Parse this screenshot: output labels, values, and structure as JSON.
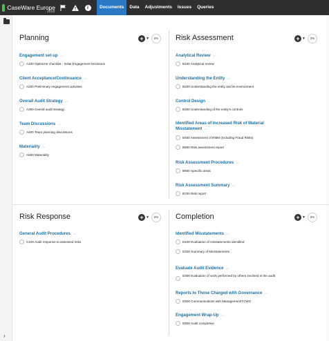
{
  "app": {
    "name": "CaseWare Europe",
    "year": "2018"
  },
  "toolbar": {
    "flag_icon": "flag-icon",
    "warning_icon": "warning-icon",
    "info_icon": "info-icon",
    "info_glyph": "i"
  },
  "nav": {
    "tabs": [
      "Documents",
      "Data",
      "Adjustments",
      "Issues",
      "Queries"
    ],
    "active": "Documents"
  },
  "panels": {
    "planning": {
      "title": "Planning",
      "pct": "0%",
      "groups": [
        {
          "title": "Engagement set-up",
          "items": [
            "A100 Optimizer checklist - Initial Engagement Decisions"
          ]
        },
        {
          "title": "Client Acceptance/Continuance",
          "items": [
            "A200 Preliminary engagement activities"
          ]
        },
        {
          "title": "Overall Audit Strategy",
          "items": [
            "A300 Overall audit strategy"
          ]
        },
        {
          "title": "Team Discussions",
          "items": [
            "A400 Team planning discussions"
          ]
        },
        {
          "title": "Materiality",
          "items": [
            "A500 Materiality"
          ]
        }
      ]
    },
    "risk_assessment": {
      "title": "Risk Assessment",
      "pct": "0%",
      "groups": [
        {
          "title": "Analytical Review",
          "items": [
            "B100 Analytical review"
          ]
        },
        {
          "title": "Understanding the Entity",
          "items": [
            "B200 Understanding the entity and its environment"
          ]
        },
        {
          "title": "Control Design",
          "items": [
            "B300 Understanding of the entity's controls"
          ]
        },
        {
          "title": "Identified Areas of Increased Risk of Material Misstatement",
          "items": [
            "B400 Assessment of RMM (including Fraud Risks)",
            "B500 Risk assessment report"
          ]
        },
        {
          "title": "Risk Assessment Procedures",
          "items": [
            "B600 Specific areas"
          ]
        },
        {
          "title": "Risk Assessment Summary",
          "items": [
            "B700 Risk report"
          ]
        }
      ]
    },
    "risk_response": {
      "title": "Risk Response",
      "pct": "0%",
      "groups": [
        {
          "title": "General Audit Procedures",
          "items": [
            "C100 Audit response to assessed risks"
          ]
        }
      ]
    },
    "completion": {
      "title": "Completion",
      "pct": "0%",
      "groups": [
        {
          "title": "Identified Misstatements",
          "items": [
            "D100 Evaluation of misstatements identified",
            "D200 Summary of Misstatements"
          ]
        },
        {
          "title": "Evaluate Audit Evidence",
          "items": [
            "D300 Evaluation of work performed by others involved in the audit"
          ]
        },
        {
          "title": "Reports to Those Charged with Governance",
          "items": [
            "D500 Communications with Management/TCWG"
          ]
        },
        {
          "title": "Engagement Wrap-Up",
          "items": [
            "D600 Audit completion"
          ]
        }
      ]
    }
  },
  "colors": {
    "topbar": "#2f2f2f",
    "active_tab": "#2b78c5",
    "group_title": "#1d6fa3",
    "brand_logo": "#5cb85c"
  }
}
